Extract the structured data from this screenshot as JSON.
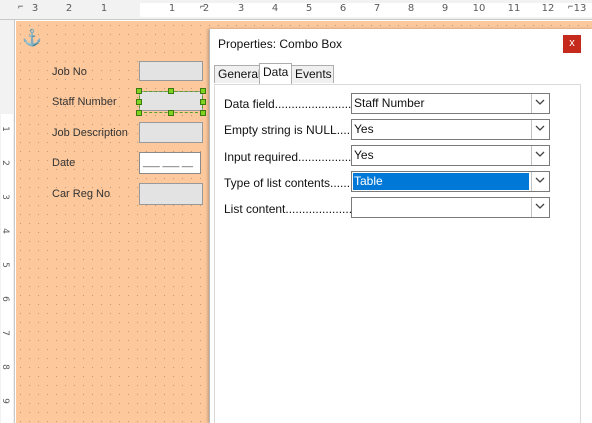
{
  "ruler": {
    "h_numbers": [
      "3",
      "2",
      "1",
      "1",
      "2",
      "3",
      "4",
      "5",
      "6",
      "7",
      "8",
      "9",
      "10",
      "11",
      "12",
      "13"
    ],
    "v_numbers": [
      "1",
      "2",
      "3",
      "4",
      "5",
      "6",
      "7",
      "8",
      "9"
    ]
  },
  "form": {
    "fields": [
      {
        "label": "Job No"
      },
      {
        "label": "Staff Number"
      },
      {
        "label": "Job Description"
      },
      {
        "label": "Date",
        "value": "___ ___ __"
      },
      {
        "label": "Car Reg No"
      }
    ]
  },
  "dialog": {
    "title": "Properties: Combo Box",
    "close_label": "x",
    "tabs": [
      {
        "label": "General"
      },
      {
        "label": "Data"
      },
      {
        "label": "Events"
      }
    ],
    "active_tab": "Data",
    "properties": [
      {
        "label": "Data field..........................",
        "value": "Staff Number"
      },
      {
        "label": "Empty string is NULL.....",
        "value": "Yes"
      },
      {
        "label": "Input required................",
        "value": "Yes"
      },
      {
        "label": "Type of list contents......",
        "value": "Table"
      },
      {
        "label": "List content.....................",
        "value": ""
      }
    ]
  },
  "colors": {
    "canvas": "#fcc89c",
    "selection_highlight": "#0078d7",
    "close_button": "#c42b1c",
    "handle": "#7ed321"
  }
}
